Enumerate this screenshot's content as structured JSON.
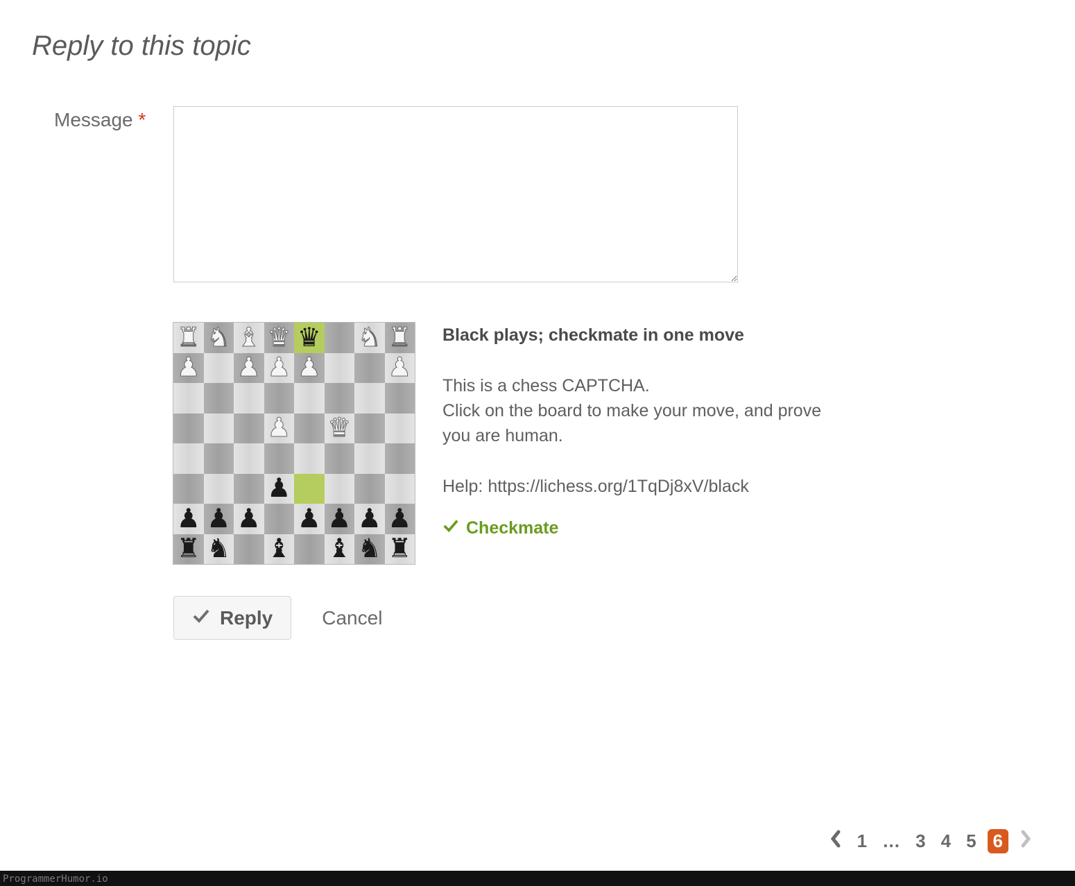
{
  "title": "Reply to this topic",
  "form": {
    "message_label": "Message",
    "required_mark": "*",
    "message_value": "",
    "message_placeholder": ""
  },
  "captcha": {
    "headline": "Black plays; checkmate in one move",
    "line1": "This is a chess CAPTCHA.",
    "line2": "Click on the board to make your move, and prove you are human.",
    "help_label": "Help: ",
    "help_link_text": "https://lichess.org/1TqDj8xV/black",
    "solved_label": "Checkmate",
    "board": {
      "rows": [
        [
          {
            "p": "wr"
          },
          {
            "p": "wn"
          },
          {
            "p": "wb"
          },
          {
            "p": "wq"
          },
          {
            "p": "bq",
            "hi": true
          },
          {
            "p": ""
          },
          {
            "p": "wn"
          },
          {
            "p": "wr"
          }
        ],
        [
          {
            "p": "wp"
          },
          {
            "p": ""
          },
          {
            "p": "wp"
          },
          {
            "p": "wp"
          },
          {
            "p": "wp"
          },
          {
            "p": ""
          },
          {
            "p": ""
          },
          {
            "p": "wp"
          }
        ],
        [
          {
            "p": ""
          },
          {
            "p": ""
          },
          {
            "p": ""
          },
          {
            "p": ""
          },
          {
            "p": ""
          },
          {
            "p": ""
          },
          {
            "p": ""
          },
          {
            "p": ""
          }
        ],
        [
          {
            "p": ""
          },
          {
            "p": ""
          },
          {
            "p": ""
          },
          {
            "p": "wp"
          },
          {
            "p": ""
          },
          {
            "p": "wq"
          },
          {
            "p": ""
          },
          {
            "p": ""
          }
        ],
        [
          {
            "p": ""
          },
          {
            "p": ""
          },
          {
            "p": ""
          },
          {
            "p": ""
          },
          {
            "p": ""
          },
          {
            "p": ""
          },
          {
            "p": ""
          },
          {
            "p": ""
          }
        ],
        [
          {
            "p": ""
          },
          {
            "p": ""
          },
          {
            "p": ""
          },
          {
            "p": "bp"
          },
          {
            "p": "",
            "hi": true
          },
          {
            "p": ""
          },
          {
            "p": ""
          },
          {
            "p": ""
          }
        ],
        [
          {
            "p": "bp"
          },
          {
            "p": "bp"
          },
          {
            "p": "bp"
          },
          {
            "p": ""
          },
          {
            "p": "bp"
          },
          {
            "p": "bp"
          },
          {
            "p": "bp"
          },
          {
            "p": "bp"
          }
        ],
        [
          {
            "p": "br"
          },
          {
            "p": "bn"
          },
          {
            "p": ""
          },
          {
            "p": "bb"
          },
          {
            "p": ""
          },
          {
            "p": "bb"
          },
          {
            "p": "bn"
          },
          {
            "p": "br"
          }
        ]
      ]
    },
    "piece_glyphs": {
      "wr": "♜",
      "wn": "♞",
      "wb": "♝",
      "wq": "♛",
      "wk": "♚",
      "wp": "♟",
      "br": "♜",
      "bn": "♞",
      "bb": "♝",
      "bq": "♛",
      "bk": "♚",
      "bp": "♟"
    }
  },
  "actions": {
    "reply_label": "Reply",
    "cancel_label": "Cancel"
  },
  "pagination": {
    "pages": [
      {
        "label": "1",
        "current": false
      },
      {
        "label": "…",
        "ellipsis": true
      },
      {
        "label": "3",
        "current": false
      },
      {
        "label": "4",
        "current": false
      },
      {
        "label": "5",
        "current": false
      },
      {
        "label": "6",
        "current": true
      }
    ],
    "prev_enabled": true,
    "next_enabled": false
  },
  "watermark": "ProgrammerHumor.io"
}
